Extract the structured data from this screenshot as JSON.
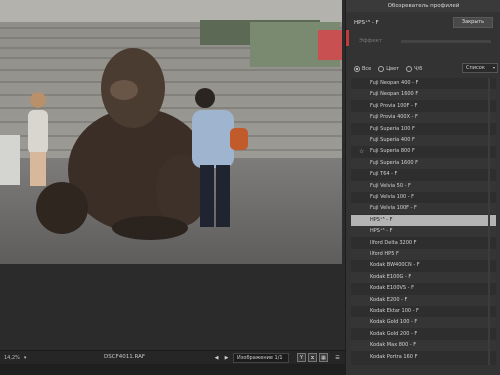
{
  "panel": {
    "title": "Обозреватель профилей",
    "selected_profile": "HPS⁺⁵ - F",
    "close_label": "Закрыть",
    "effect_label": "Эффект",
    "filters": [
      {
        "label": "Все",
        "checked": true
      },
      {
        "label": "Цвет",
        "checked": false
      },
      {
        "label": "Ч/б",
        "checked": false
      }
    ],
    "view_select": "Список",
    "profiles": [
      "Fuji Neopan 400 - F",
      "Fuji Neopan 1600 F",
      "Fuji Provia 100F - F",
      "Fuji Provia 400X - F",
      "Fuji Superia 100 F",
      "Fuji Superia 400 F",
      "Fuji Superia 800 F",
      "Fuji Superia 1600 F",
      "Fuji T64 - F",
      "Fuji Velvia 50 - F",
      "Fuji Velvia 100 - F",
      "Fuji Velvia 100F - F",
      "HPS⁺⁵ - F",
      "HPS⁺⁵ - F",
      "Ilford Delta 3200 F",
      "Ilford HP5 F",
      "Kodak BW400CN - F",
      "Kodak E100G - F",
      "Kodak E100VS - F",
      "Kodak E200 - F",
      "Kodak Ektar 100 - F",
      "Kodak Gold 100 - F",
      "Kodak Gold 200 - F",
      "Kodak Max 800 - F",
      "Kodak Portra 160 F"
    ],
    "selected_index": 12,
    "starred_index": 6
  },
  "status": {
    "zoom": "14,2%",
    "filename": "DSCF4011.RAF",
    "image_counter": "Изображение 1/1"
  },
  "icons": {
    "prev": "triangle-left",
    "next": "triangle-right",
    "compare": "y-compare",
    "menu": "hamburger"
  }
}
